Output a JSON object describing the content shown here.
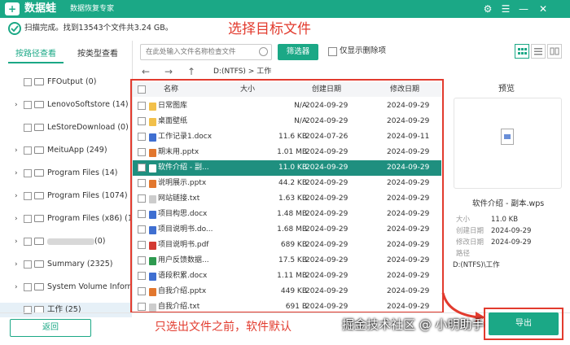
{
  "app": {
    "logo_char": "+",
    "name": "数据蛙",
    "subtitle": "数据恢复专家",
    "window": {
      "settings": "⚙",
      "menu": "☰",
      "minimize": "—",
      "close": "✕"
    }
  },
  "status": {
    "text": "扫描完成。找到13543个文件共3.24 GB。"
  },
  "annotations": {
    "title": "选择目标文件",
    "bottom": "只选出文件之前，软件默认"
  },
  "watermark": "掘金技术社区 @ 小明助手",
  "left_tabs": {
    "by_path": "按路径查看",
    "by_type": "按类型查看"
  },
  "tree": [
    {
      "label": "FFOutput (0)",
      "has_arrow": false
    },
    {
      "label": "LenovoSoftstore (14)",
      "has_arrow": true
    },
    {
      "label": "LeStoreDownload (0)",
      "has_arrow": false
    },
    {
      "label": "MeituApp (249)",
      "has_arrow": true
    },
    {
      "label": "Program Files (14)",
      "has_arrow": true
    },
    {
      "label": "Program Files (1074)",
      "has_arrow": true
    },
    {
      "label": "Program Files (x86) (197",
      "has_arrow": true
    },
    {
      "label": "(0)",
      "has_arrow": true,
      "blurred": true
    },
    {
      "label": "Summary (2325)",
      "has_arrow": true
    },
    {
      "label": "System Volume Informat",
      "has_arrow": true
    },
    {
      "label": "工作 (25)",
      "has_arrow": false,
      "selected": true
    }
  ],
  "toolbar": {
    "search_placeholder": "在此处输入文件名称检查文件",
    "filter_label": "筛选器",
    "deleted_only_label": "仅显示删除项"
  },
  "nav": {
    "back": "←",
    "forward": "→",
    "up": "↑",
    "path": "D:(NTFS) > 工作"
  },
  "table": {
    "headers": {
      "name": "名称",
      "size": "大小",
      "created": "创建日期",
      "modified": "修改日期"
    },
    "rows": [
      {
        "name": "日常图库",
        "size": "N/A",
        "created": "2024-09-29",
        "modified": "2024-09-29",
        "icon_color": "#f2c04a"
      },
      {
        "name": "桌面壁纸",
        "size": "N/A",
        "created": "2024-09-29",
        "modified": "2024-09-29",
        "icon_color": "#f2c04a"
      },
      {
        "name": "工作记录1.docx",
        "size": "11.6 KB",
        "created": "2024-07-26",
        "modified": "2024-09-11",
        "icon_color": "#3f6fd1"
      },
      {
        "name": "期末用.pptx",
        "size": "1.01 MB",
        "created": "2024-09-29",
        "modified": "2024-09-29",
        "icon_color": "#e2772e"
      },
      {
        "name": "软件介绍 - 副...",
        "size": "11.0 KB",
        "created": "2024-09-29",
        "modified": "2024-09-29",
        "icon_color": "#ffffff",
        "selected": true
      },
      {
        "name": "说明展示.pptx",
        "size": "44.2 KB",
        "created": "2024-09-29",
        "modified": "2024-09-29",
        "icon_color": "#e2772e"
      },
      {
        "name": "网站链接.txt",
        "size": "1.63 KB",
        "created": "2024-09-29",
        "modified": "2024-09-29",
        "icon_color": "#cccccc"
      },
      {
        "name": "项目构思.docx",
        "size": "1.48 MB",
        "created": "2024-09-29",
        "modified": "2024-09-29",
        "icon_color": "#3f6fd1"
      },
      {
        "name": "项目说明书.do...",
        "size": "1.68 MB",
        "created": "2024-09-29",
        "modified": "2024-09-29",
        "icon_color": "#3f6fd1"
      },
      {
        "name": "项目说明书.pdf",
        "size": "689 KB",
        "created": "2024-09-29",
        "modified": "2024-09-29",
        "icon_color": "#d33a32"
      },
      {
        "name": "用户反馈数据...",
        "size": "17.5 KB",
        "created": "2024-09-29",
        "modified": "2024-09-29",
        "icon_color": "#2e9a4f"
      },
      {
        "name": "语段积累.docx",
        "size": "1.11 MB",
        "created": "2024-09-29",
        "modified": "2024-09-29",
        "icon_color": "#3f6fd1"
      },
      {
        "name": "自我介绍.pptx",
        "size": "449 KB",
        "created": "2024-09-29",
        "modified": "2024-09-29",
        "icon_color": "#e2772e"
      },
      {
        "name": "自我介绍.txt",
        "size": "691 B",
        "created": "2024-09-29",
        "modified": "2024-09-29",
        "icon_color": "#cccccc"
      }
    ]
  },
  "preview": {
    "title": "预览",
    "file_name": "软件介绍 - 副本.wps",
    "meta": [
      {
        "label": "大小",
        "value": "11.0 KB"
      },
      {
        "label": "创建日期",
        "value": "2024-09-29"
      },
      {
        "label": "修改日期",
        "value": "2024-09-29"
      },
      {
        "label": "路径",
        "value": ""
      }
    ],
    "path_value": "D:(NTFS)\\工作"
  },
  "bottom": {
    "back_label": "返回",
    "export_label": "导出"
  },
  "colors": {
    "brand": "#1ba886",
    "annotation": "#e23b2e",
    "selected_row": "#1f8f7f"
  }
}
